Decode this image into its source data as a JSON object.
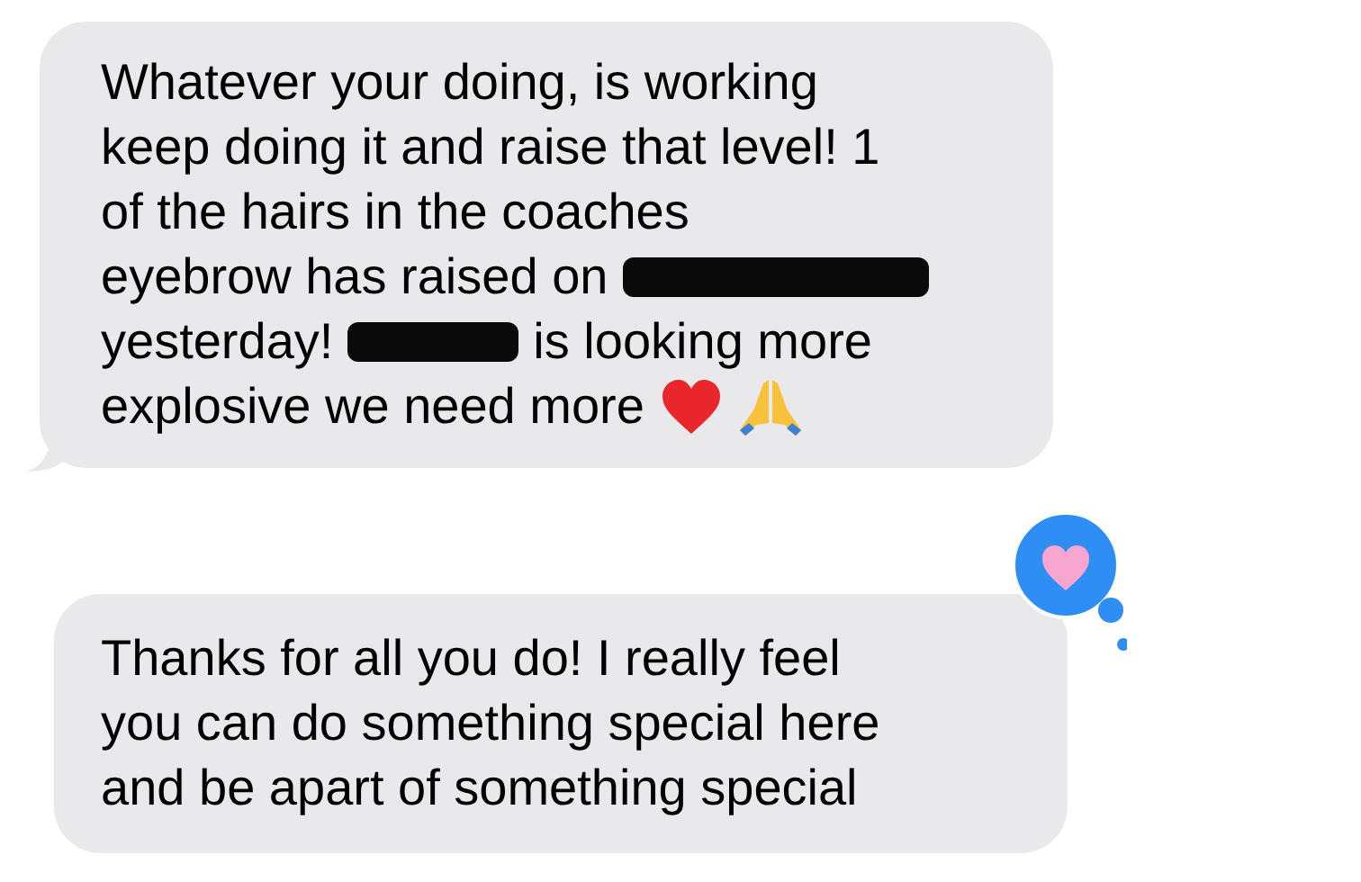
{
  "messages": [
    {
      "reacted": false,
      "lines": [
        [
          {
            "kind": "text",
            "text": "Whatever your doing, is working"
          }
        ],
        [
          {
            "kind": "text",
            "text": "keep doing it and raise that level! 1"
          }
        ],
        [
          {
            "kind": "text",
            "text": "of the hairs in the coaches"
          }
        ],
        [
          {
            "kind": "text",
            "text": "eyebrow has raised on"
          },
          {
            "kind": "redaction"
          }
        ],
        [
          {
            "kind": "text",
            "text": "yesterday!"
          },
          {
            "kind": "redaction"
          },
          {
            "kind": "text",
            "text": "is looking more"
          }
        ],
        [
          {
            "kind": "text",
            "text": "explosive we need more"
          },
          {
            "kind": "heart"
          },
          {
            "kind": "pray"
          }
        ]
      ]
    },
    {
      "reacted": true,
      "lines": [
        [
          {
            "kind": "text",
            "text": "Thanks for all you do! I really feel"
          }
        ],
        [
          {
            "kind": "text",
            "text": "you can do something special here"
          }
        ],
        [
          {
            "kind": "text",
            "text": "and be apart of something special"
          }
        ]
      ]
    }
  ]
}
